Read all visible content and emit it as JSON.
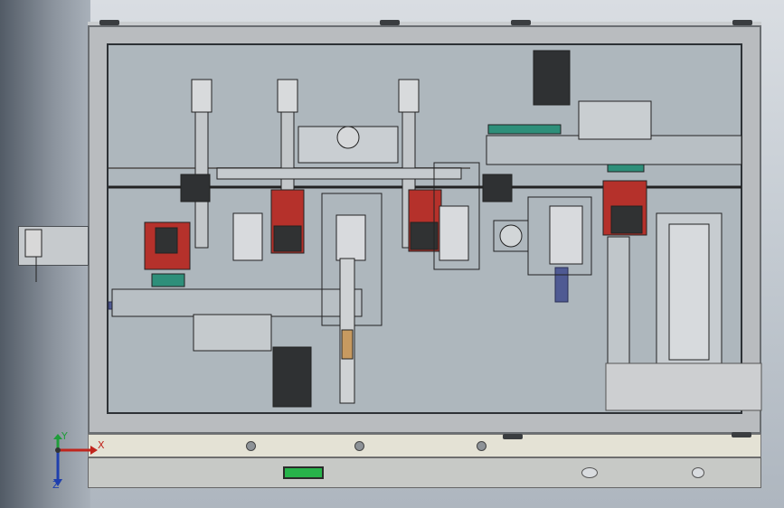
{
  "viewport": {
    "name": "cad-3d-assembly-view"
  },
  "display_panel": {
    "text": ""
  },
  "triad": {
    "x_label": "X",
    "y_label": "Y",
    "z_label": "Z"
  },
  "colors": {
    "red_block": "#b5312b",
    "teal": "#2e8f7a",
    "blue_rail": "#4f5a93",
    "green_lcd": "#27b34a"
  }
}
